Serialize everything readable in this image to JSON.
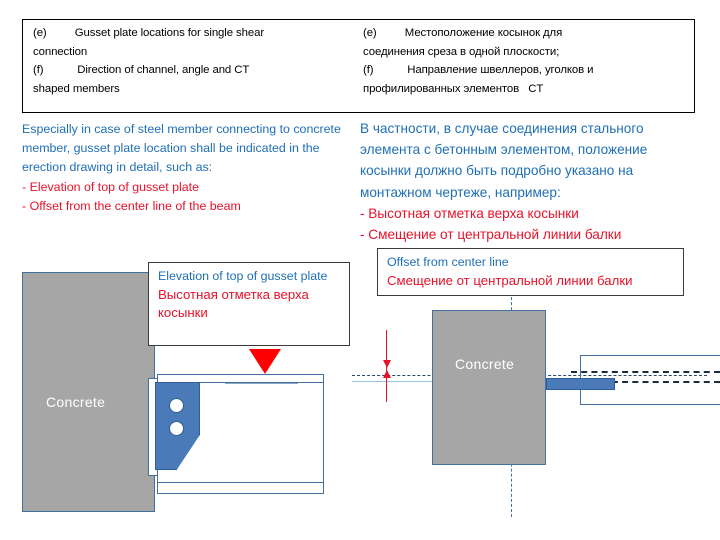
{
  "header_box": {
    "english": [
      "(e)   Gusset plate locations for single shear",
      "connection",
      "(f)    Direction of channel, angle and CT",
      "shaped members"
    ],
    "russian": [
      "(e)   Местоположение косынок для",
      "соединения среза в одной плоскости;",
      "(f)    Направление швеллеров, уголков и",
      "профилированных элементов   CT"
    ]
  },
  "body": {
    "english_paragraph": "Especially in case of steel member connecting to concrete member, gusset plate location shall be indicated in the erection drawing in detail, such as:",
    "english_bullets": [
      "- Elevation of top of gusset plate",
      "- Offset from the center line of the beam"
    ],
    "russian_paragraph": "В частности, в случае соединения стального элемента с бетонным элементом, положение косынки должно быть подробно указано на монтажном чертеже, например:",
    "russian_bullets": [
      "- Высотная отметка верха косынки",
      "- Смещение от центральной линии балки"
    ]
  },
  "callouts": {
    "elevation": {
      "english": "Elevation of top of gusset plate",
      "russian": "Высотная отметка верха косынки"
    },
    "offset": {
      "english": "Offset from center line",
      "russian": "Смещение от центральной линии балки"
    }
  },
  "diagram": {
    "elevation_view": {
      "concrete_label": "Concrete"
    },
    "plan_view": {
      "concrete_label": "Concrete"
    }
  },
  "colors": {
    "text_blue": "#1F6FB5",
    "text_red": "#E8122A",
    "steel_blue": "#4A7AB8",
    "outline_blue": "#41719C",
    "concrete_gray": "#A6A6A6",
    "marker_red": "#FF0000"
  }
}
